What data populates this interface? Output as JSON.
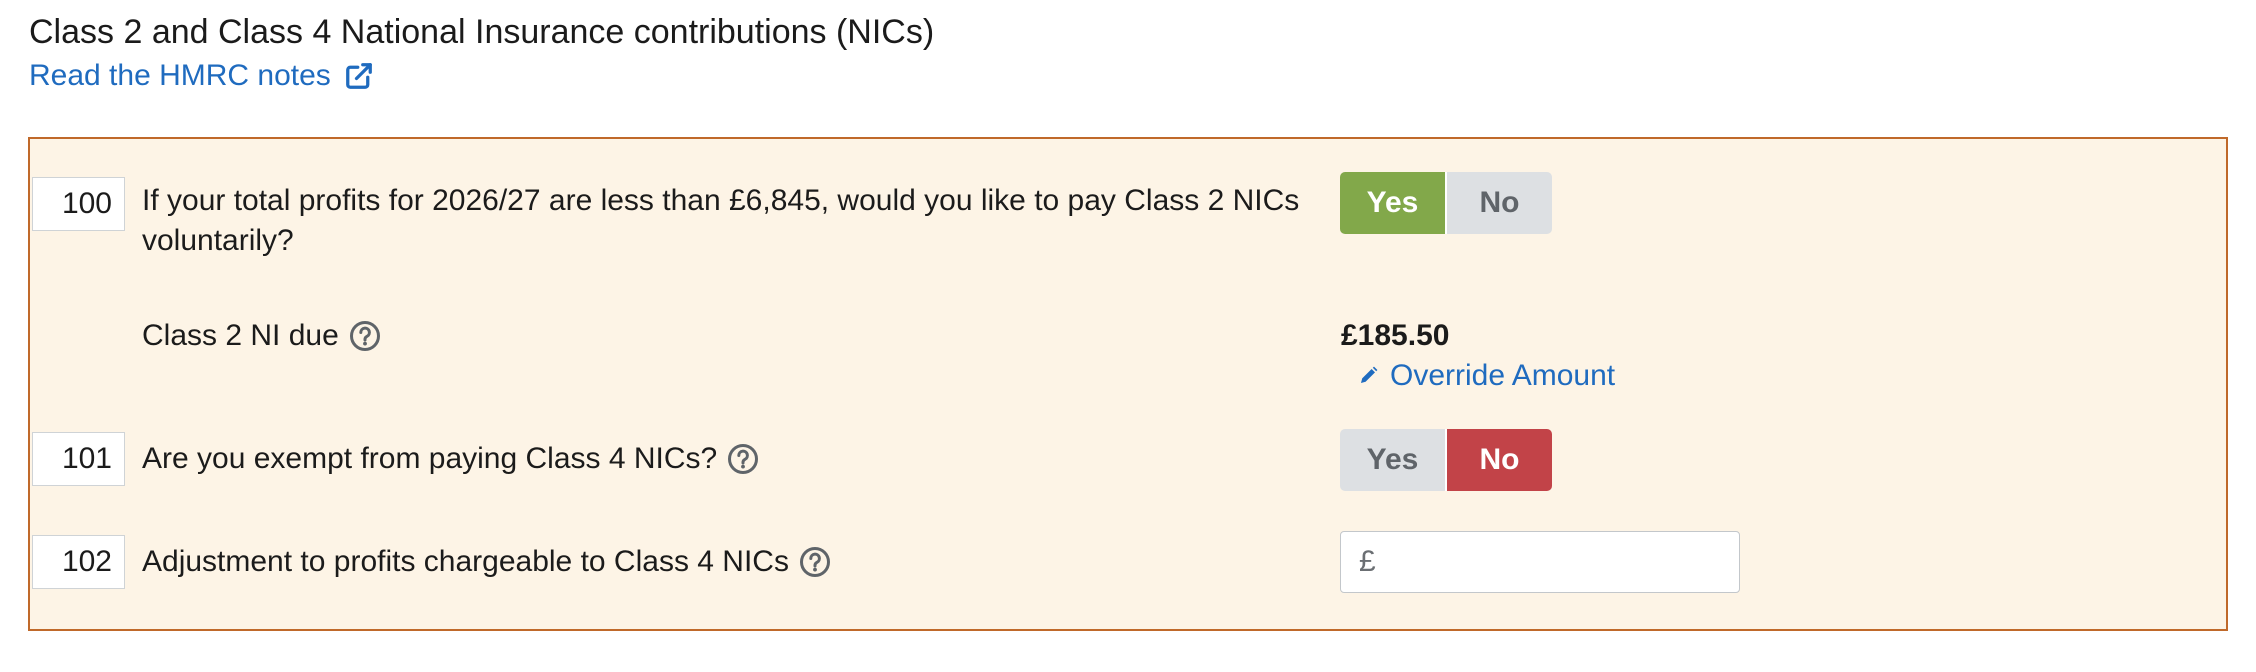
{
  "section": {
    "title": "Class 2 and Class 4 National Insurance contributions (NICs)",
    "notes_link": "Read the HMRC notes",
    "notes_icon": "external-link-icon"
  },
  "colors": {
    "link": "#1f6bbf",
    "panel_bg": "#fdf4e6",
    "panel_border": "#c0692a",
    "yes_selected": "#82a84a",
    "no_selected": "#c24348",
    "unselected": "#dde0e3"
  },
  "questions": [
    {
      "box": "100",
      "text": "If your total profits for 2026/27 are less than £6,845, would you like to pay Class 2 NICs voluntarily?",
      "yes_label": "Yes",
      "no_label": "No",
      "selected": "Yes"
    },
    {
      "box": "101",
      "text": "Are you exempt from paying Class 4 NICs?",
      "help_icon": "question-circle-icon",
      "yes_label": "Yes",
      "no_label": "No",
      "selected": "No"
    },
    {
      "box": "102",
      "text": "Adjustment to profits chargeable to Class 4 NICs",
      "help_icon": "question-circle-icon",
      "currency": "£",
      "value": "",
      "placeholder": ""
    }
  ],
  "class2_due": {
    "label": "Class 2 NI due",
    "help_icon": "question-circle-icon",
    "amount": "£185.50",
    "override_label": "Override Amount",
    "override_icon": "pencil-icon"
  }
}
